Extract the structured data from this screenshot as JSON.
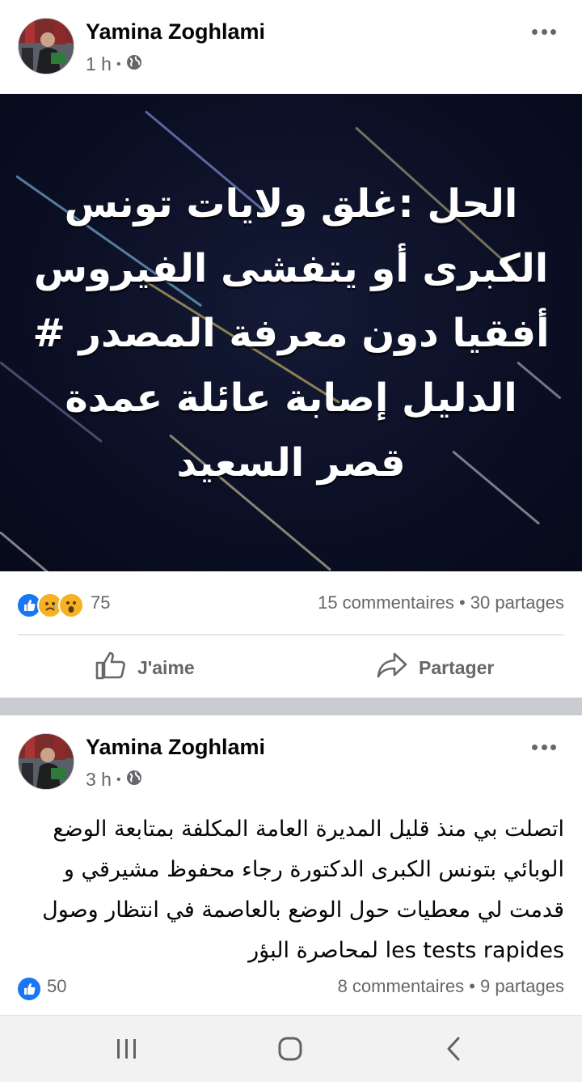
{
  "post1": {
    "author": "Yamina Zoghlami",
    "time": "1 h",
    "privacy_icon": "globe-icon",
    "banner_lines": [
      "الحل :غلق ولايات تونس",
      "الكبرى أو يتفشى الفيروس",
      "أفقيا دون معرفة المصدر #",
      "الدليل إصابة عائلة عمدة",
      "قصر السعيد"
    ],
    "reaction_icons": [
      "like-icon",
      "sad-icon",
      "wow-icon"
    ],
    "reaction_count": "75",
    "comments": "15 commentaires",
    "shares": "30 partages",
    "like_label": "J'aime",
    "share_label": "Partager"
  },
  "post2": {
    "author": "Yamina Zoghlami",
    "time": "3 h",
    "privacy_icon": "globe-icon",
    "text_lines": [
      "اتصلت بي منذ قليل المديرة العامة المكلفة بمتابعة الوضع",
      "الوبائي بتونس الكبرى الدكتورة رجاء محفوظ مشيرقي و",
      "قدمت لي معطيات حول الوضع بالعاصمة في انتظار وصول",
      "les tests rapides لمحاصرة البؤر"
    ],
    "reaction_icons": [
      "like-icon"
    ],
    "reaction_count": "50",
    "comments": "8 commentaires",
    "shares": "9 partages"
  },
  "colors": {
    "accent": "#1877f2",
    "secondary_text": "#65676b",
    "banner_bg": "#0b0f24",
    "feed_bg": "#c9ccd1"
  },
  "navbar": {
    "items": [
      "recent-apps-icon",
      "home-icon",
      "back-icon"
    ]
  }
}
